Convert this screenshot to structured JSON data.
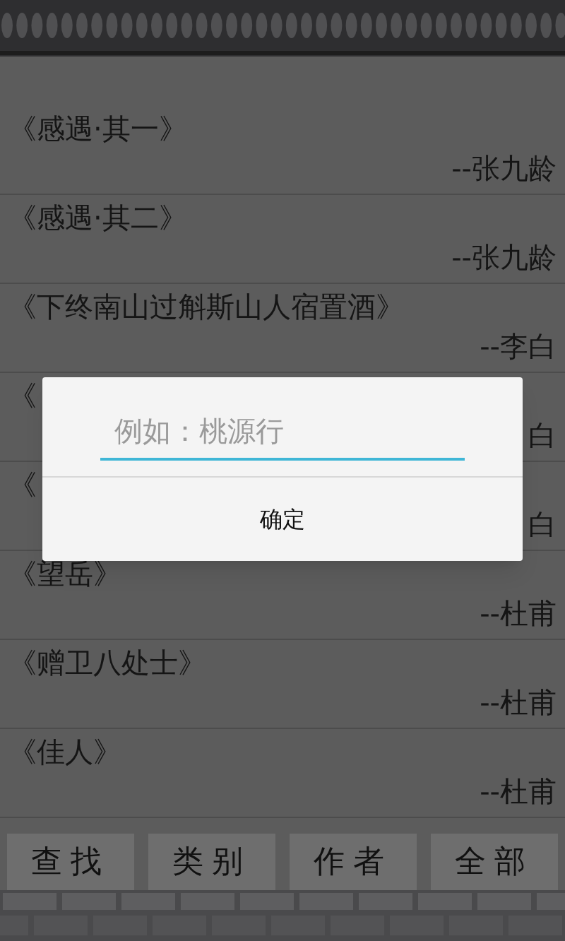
{
  "poems": [
    {
      "title": "《感遇·其一》",
      "author": "--张九龄"
    },
    {
      "title": "《感遇·其二》",
      "author": "--张九龄"
    },
    {
      "title": "《下终南山过斛斯山人宿置酒》",
      "author": "--李白"
    },
    {
      "title": "《",
      "author": "白"
    },
    {
      "title": "《",
      "author": "白"
    },
    {
      "title": "《望岳》",
      "author": "--杜甫"
    },
    {
      "title": "《赠卫八处士》",
      "author": "--杜甫"
    },
    {
      "title": "《佳人》",
      "author": "--杜甫"
    }
  ],
  "dialog": {
    "placeholder": "例如：桃源行",
    "button": "确定"
  },
  "bottom_bar": [
    "查找",
    "类别",
    "作者",
    "全部"
  ]
}
